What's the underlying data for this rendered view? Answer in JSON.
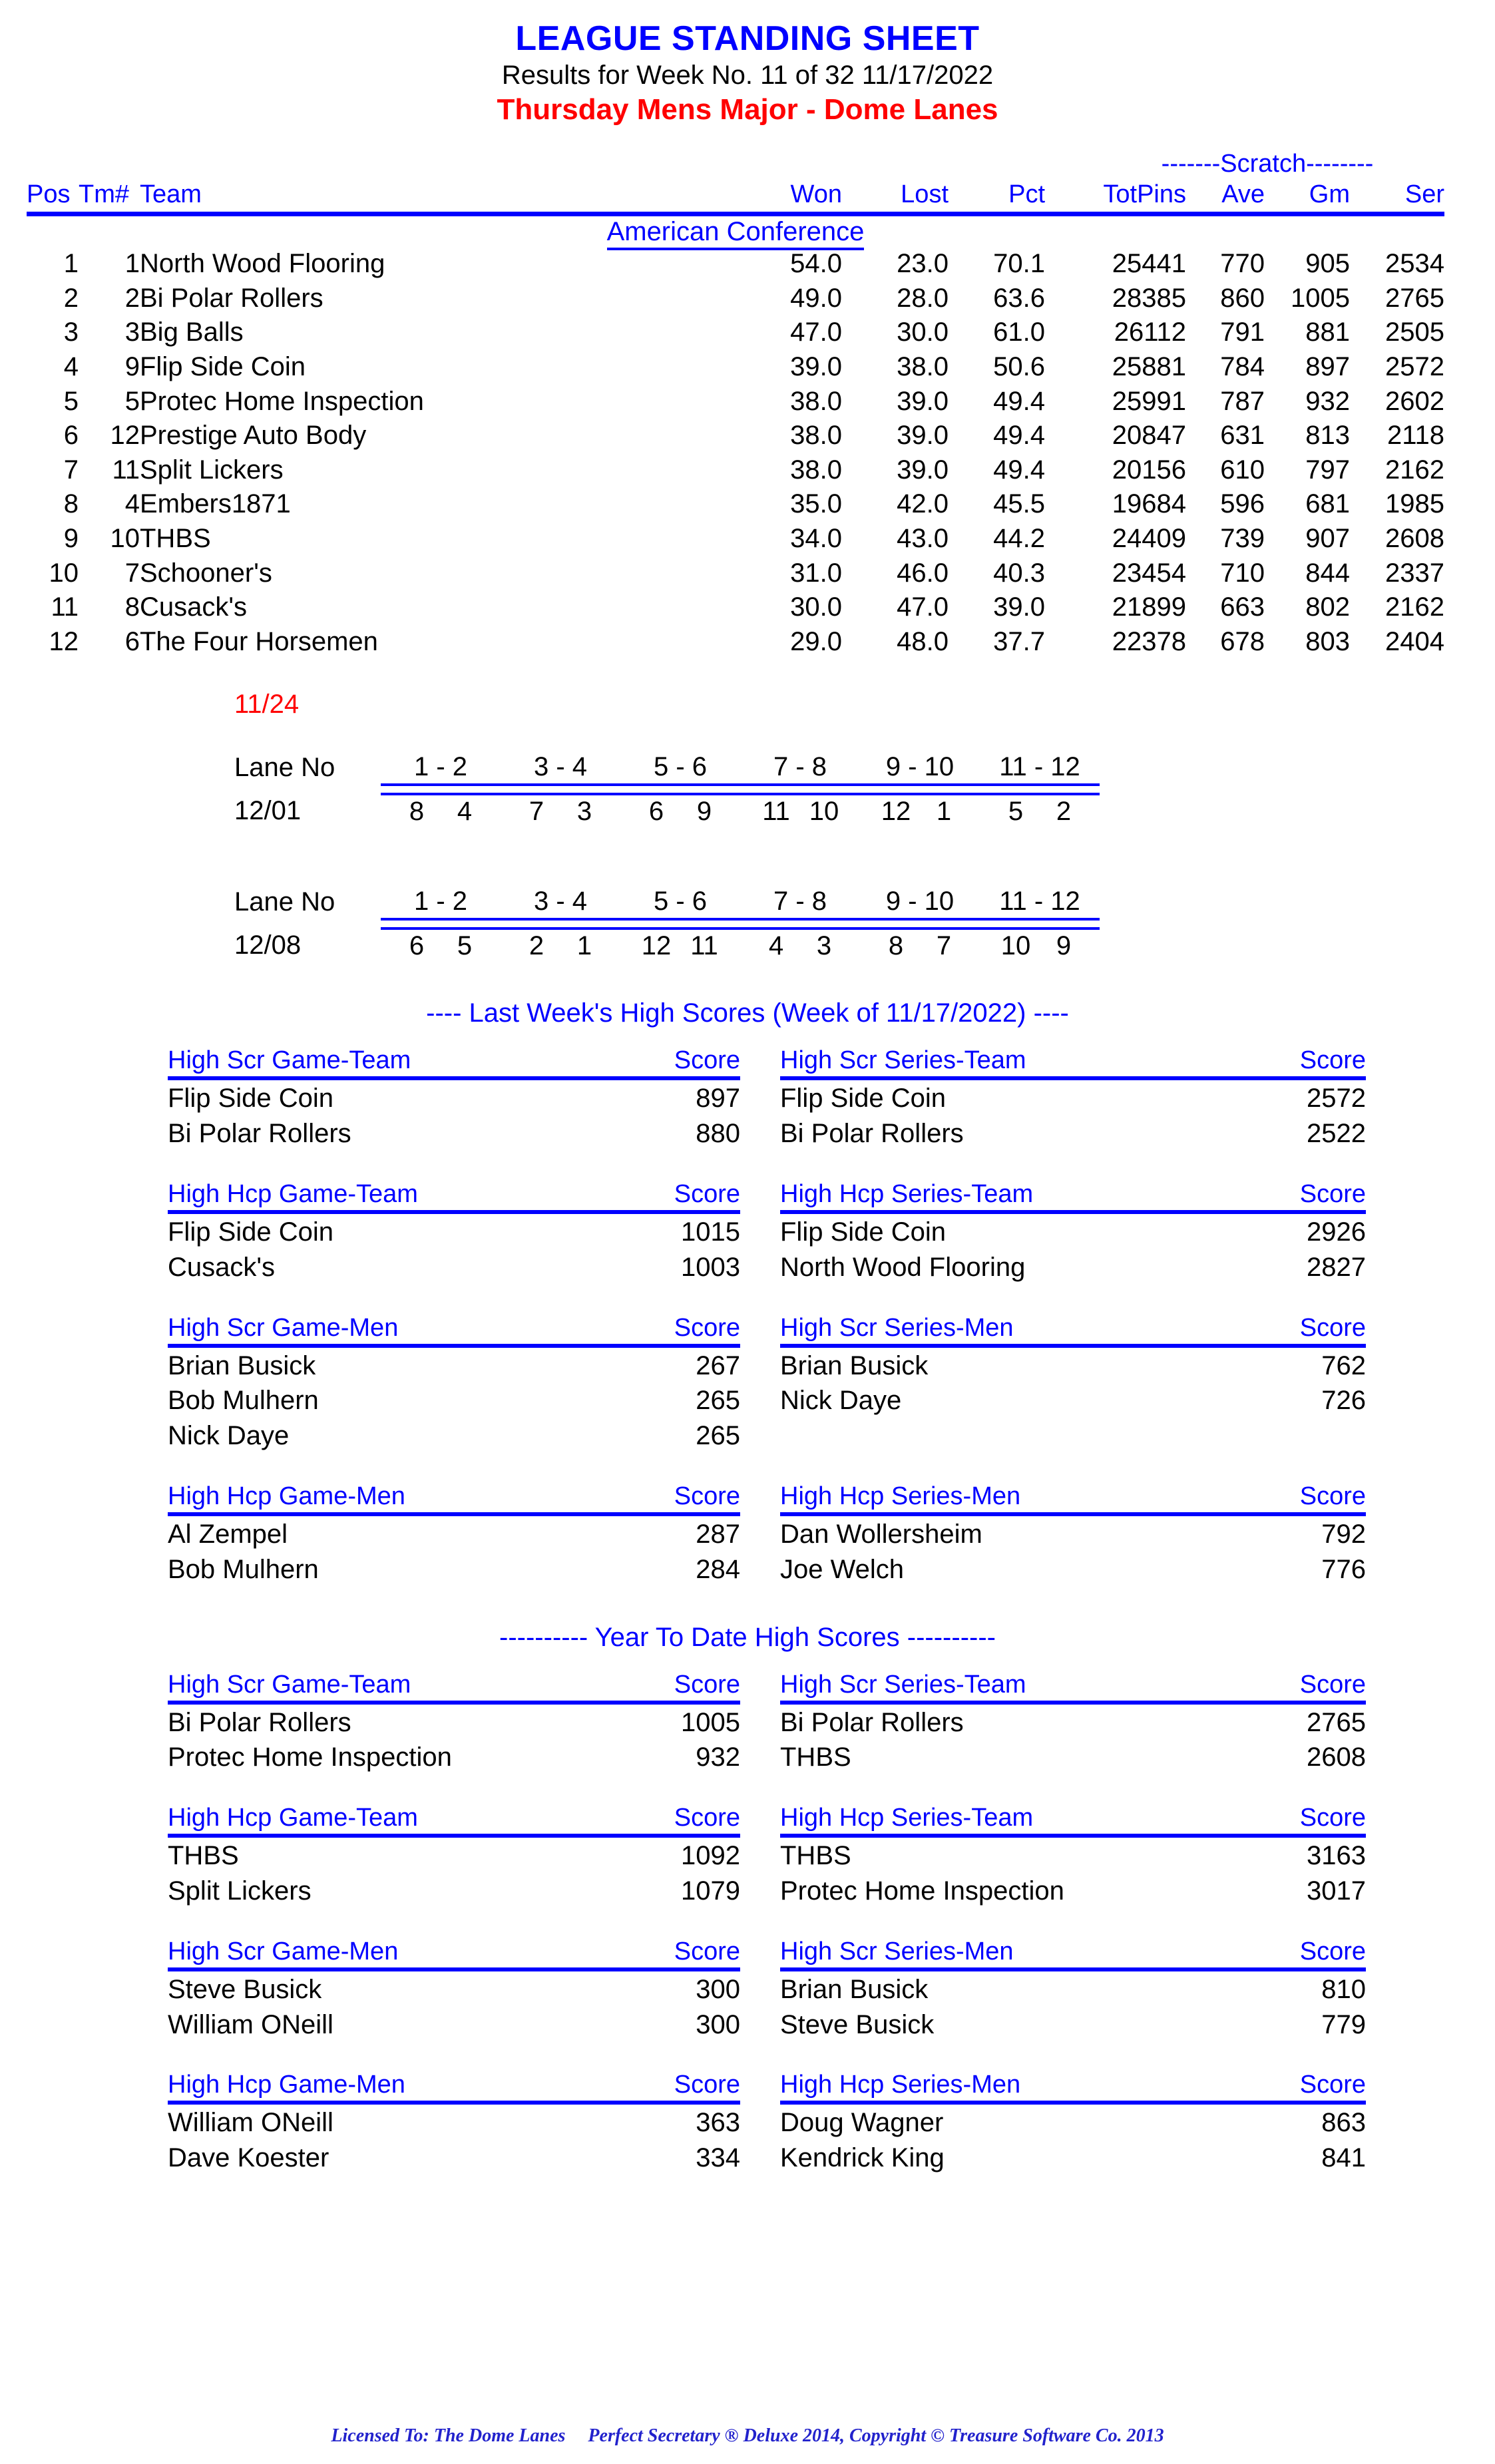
{
  "header": {
    "title": "LEAGUE STANDING SHEET",
    "subtitle": "Results for Week No. 11 of 32    11/17/2022",
    "league": "Thursday Mens Major - Dome Lanes",
    "title_color": "#0000ff",
    "league_color": "#ff0000"
  },
  "standings": {
    "group_label": "-------Scratch--------",
    "columns": {
      "pos": "Pos",
      "team_no": "Tm#",
      "team": "Team",
      "won": "Won",
      "lost": "Lost",
      "pct": "Pct",
      "totpins": "TotPins",
      "ave": "Ave",
      "gm": "Gm",
      "ser": "Ser"
    },
    "conference": "American Conference",
    "rows": [
      {
        "pos": "1",
        "tm": "1",
        "team": "North Wood Flooring",
        "won": "54.0",
        "lost": "23.0",
        "pct": "70.1",
        "totpins": "25441",
        "ave": "770",
        "gm": "905",
        "ser": "2534"
      },
      {
        "pos": "2",
        "tm": "2",
        "team": "Bi Polar Rollers",
        "won": "49.0",
        "lost": "28.0",
        "pct": "63.6",
        "totpins": "28385",
        "ave": "860",
        "gm": "1005",
        "ser": "2765"
      },
      {
        "pos": "3",
        "tm": "3",
        "team": "Big Balls",
        "won": "47.0",
        "lost": "30.0",
        "pct": "61.0",
        "totpins": "26112",
        "ave": "791",
        "gm": "881",
        "ser": "2505"
      },
      {
        "pos": "4",
        "tm": "9",
        "team": "Flip Side Coin",
        "won": "39.0",
        "lost": "38.0",
        "pct": "50.6",
        "totpins": "25881",
        "ave": "784",
        "gm": "897",
        "ser": "2572"
      },
      {
        "pos": "5",
        "tm": "5",
        "team": "Protec Home Inspection",
        "won": "38.0",
        "lost": "39.0",
        "pct": "49.4",
        "totpins": "25991",
        "ave": "787",
        "gm": "932",
        "ser": "2602"
      },
      {
        "pos": "6",
        "tm": "12",
        "team": "Prestige Auto Body",
        "won": "38.0",
        "lost": "39.0",
        "pct": "49.4",
        "totpins": "20847",
        "ave": "631",
        "gm": "813",
        "ser": "2118"
      },
      {
        "pos": "7",
        "tm": "11",
        "team": "Split Lickers",
        "won": "38.0",
        "lost": "39.0",
        "pct": "49.4",
        "totpins": "20156",
        "ave": "610",
        "gm": "797",
        "ser": "2162"
      },
      {
        "pos": "8",
        "tm": "4",
        "team": "Embers1871",
        "won": "35.0",
        "lost": "42.0",
        "pct": "45.5",
        "totpins": "19684",
        "ave": "596",
        "gm": "681",
        "ser": "1985"
      },
      {
        "pos": "9",
        "tm": "10",
        "team": "THBS",
        "won": "34.0",
        "lost": "43.0",
        "pct": "44.2",
        "totpins": "24409",
        "ave": "739",
        "gm": "907",
        "ser": "2608"
      },
      {
        "pos": "10",
        "tm": "7",
        "team": "Schooner's",
        "won": "31.0",
        "lost": "46.0",
        "pct": "40.3",
        "totpins": "23454",
        "ave": "710",
        "gm": "844",
        "ser": "2337"
      },
      {
        "pos": "11",
        "tm": "8",
        "team": "Cusack's",
        "won": "30.0",
        "lost": "47.0",
        "pct": "39.0",
        "totpins": "21899",
        "ave": "663",
        "gm": "802",
        "ser": "2162"
      },
      {
        "pos": "12",
        "tm": "6",
        "team": "The Four Horsemen",
        "won": "29.0",
        "lost": "48.0",
        "pct": "37.7",
        "totpins": "22378",
        "ave": "678",
        "gm": "803",
        "ser": "2404"
      }
    ]
  },
  "schedule": {
    "off_week_date": "11/24",
    "lane_label": "Lane No",
    "lane_pairs": [
      "1 - 2",
      "3 - 4",
      "5 - 6",
      "7 - 8",
      "9 - 10",
      "11 - 12"
    ],
    "weeks": [
      {
        "date": "12/01",
        "matchups": [
          [
            "8",
            "4"
          ],
          [
            "7",
            "3"
          ],
          [
            "6",
            "9"
          ],
          [
            "11",
            "10"
          ],
          [
            "12",
            "1"
          ],
          [
            "5",
            "2"
          ]
        ]
      },
      {
        "date": "12/08",
        "matchups": [
          [
            "6",
            "5"
          ],
          [
            "2",
            "1"
          ],
          [
            "12",
            "11"
          ],
          [
            "4",
            "3"
          ],
          [
            "8",
            "7"
          ],
          [
            "10",
            "9"
          ]
        ]
      }
    ]
  },
  "last_week": {
    "section_title": "----  Last Week's High Scores   (Week of 11/17/2022)  ----",
    "score_label": "Score",
    "tables": [
      {
        "title": "High Scr Game-Team",
        "entries": [
          {
            "name": "Flip Side Coin",
            "score": "897"
          },
          {
            "name": "Bi Polar Rollers",
            "score": "880"
          }
        ]
      },
      {
        "title": "High Scr Series-Team",
        "entries": [
          {
            "name": "Flip Side Coin",
            "score": "2572"
          },
          {
            "name": "Bi Polar Rollers",
            "score": "2522"
          }
        ]
      },
      {
        "title": "High Hcp Game-Team",
        "entries": [
          {
            "name": "Flip Side Coin",
            "score": "1015"
          },
          {
            "name": "Cusack's",
            "score": "1003"
          }
        ]
      },
      {
        "title": "High Hcp Series-Team",
        "entries": [
          {
            "name": "Flip Side Coin",
            "score": "2926"
          },
          {
            "name": "North Wood Flooring",
            "score": "2827"
          }
        ]
      },
      {
        "title": "High Scr Game-Men",
        "entries": [
          {
            "name": "Brian Busick",
            "score": "267"
          },
          {
            "name": "Bob Mulhern",
            "score": "265"
          },
          {
            "name": "Nick Daye",
            "score": "265"
          }
        ]
      },
      {
        "title": "High Scr Series-Men",
        "entries": [
          {
            "name": "Brian Busick",
            "score": "762"
          },
          {
            "name": "Nick Daye",
            "score": "726"
          }
        ]
      },
      {
        "title": "High Hcp Game-Men",
        "entries": [
          {
            "name": "Al Zempel",
            "score": "287"
          },
          {
            "name": "Bob Mulhern",
            "score": "284"
          }
        ]
      },
      {
        "title": "High Hcp Series-Men",
        "entries": [
          {
            "name": "Dan Wollersheim",
            "score": "792"
          },
          {
            "name": "Joe Welch",
            "score": "776"
          }
        ]
      }
    ]
  },
  "year_to_date": {
    "section_title": "---------- Year To Date High Scores ----------",
    "score_label": "Score",
    "tables": [
      {
        "title": "High Scr Game-Team",
        "entries": [
          {
            "name": "Bi Polar Rollers",
            "score": "1005"
          },
          {
            "name": "Protec Home Inspection",
            "score": "932"
          }
        ]
      },
      {
        "title": "High Scr Series-Team",
        "entries": [
          {
            "name": "Bi Polar Rollers",
            "score": "2765"
          },
          {
            "name": "THBS",
            "score": "2608"
          }
        ]
      },
      {
        "title": "High Hcp Game-Team",
        "entries": [
          {
            "name": "THBS",
            "score": "1092"
          },
          {
            "name": "Split Lickers",
            "score": "1079"
          }
        ]
      },
      {
        "title": "High Hcp Series-Team",
        "entries": [
          {
            "name": "THBS",
            "score": "3163"
          },
          {
            "name": "Protec Home Inspection",
            "score": "3017"
          }
        ]
      },
      {
        "title": "High Scr Game-Men",
        "entries": [
          {
            "name": "Steve Busick",
            "score": "300"
          },
          {
            "name": "William ONeill",
            "score": "300"
          }
        ]
      },
      {
        "title": "High Scr Series-Men",
        "entries": [
          {
            "name": "Brian Busick",
            "score": "810"
          },
          {
            "name": "Steve Busick",
            "score": "779"
          }
        ]
      },
      {
        "title": "High Hcp Game-Men",
        "entries": [
          {
            "name": "William ONeill",
            "score": "363"
          },
          {
            "name": "Dave Koester",
            "score": "334"
          }
        ]
      },
      {
        "title": "High Hcp Series-Men",
        "entries": [
          {
            "name": "Doug Wagner",
            "score": "863"
          },
          {
            "name": "Kendrick King",
            "score": "841"
          }
        ]
      }
    ]
  },
  "footer": {
    "licensed_to": "Licensed To: The Dome Lanes",
    "software": "Perfect Secretary ® Deluxe  2014, Copyright © Treasure Software Co. 2013"
  }
}
